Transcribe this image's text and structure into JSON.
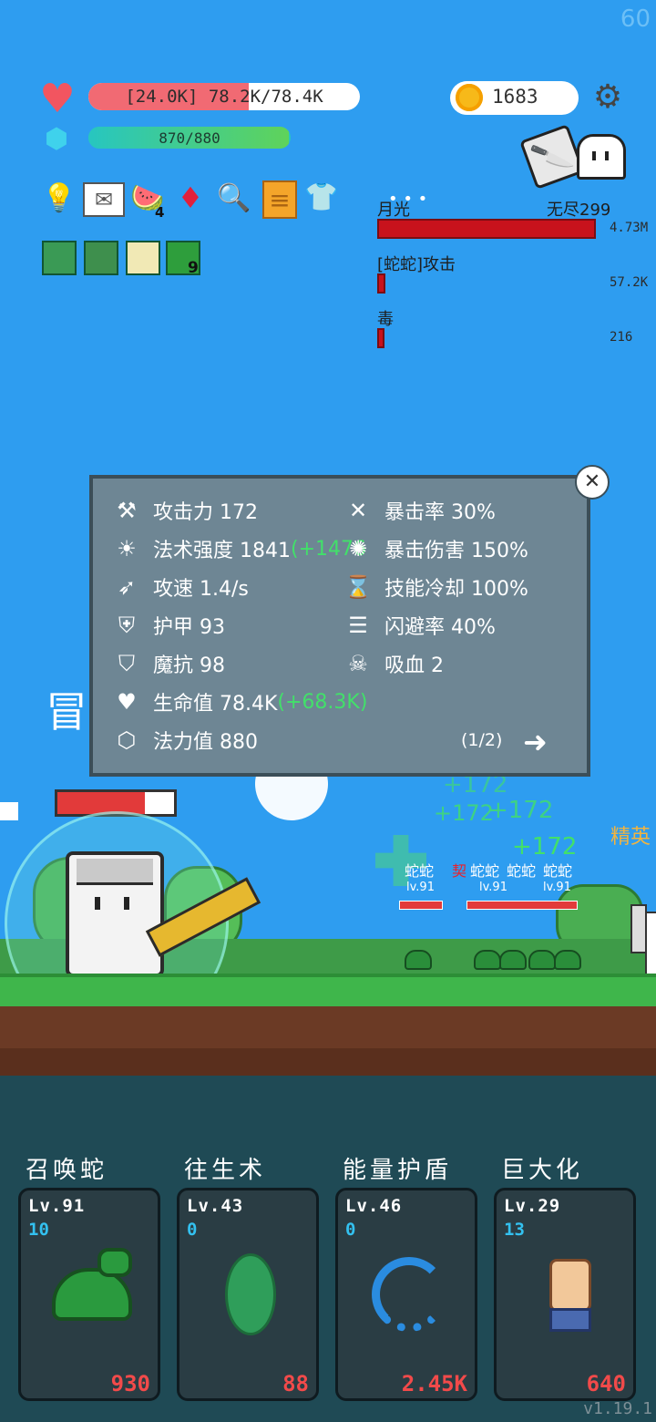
{
  "fps": "60",
  "player": {
    "hp_text": "[24.0K] 78.2K/78.4K",
    "hp_fraction": 0.59,
    "mp_text": "870/880",
    "mp_fraction": 0.99
  },
  "gold": "1683",
  "inventory_badges": {
    "watermelon_count": "4",
    "buff_count": "9"
  },
  "damage_panel": {
    "rows": [
      {
        "name": "月光",
        "mode": "无尽299",
        "value": "4.73M",
        "fraction": 1.0
      },
      {
        "name": "[蛇蛇]攻击",
        "value": "57.2K",
        "fraction": 0.02
      },
      {
        "name": "毒",
        "value": "216",
        "fraction": 0.01
      }
    ]
  },
  "stats": {
    "attack": "攻击力 172",
    "spell_power_base": "法术强度 1841",
    "spell_power_bonus": "(+1476",
    "attack_speed": "攻速 1.4/s",
    "armor": "护甲 93",
    "magic_resist": "魔抗 98",
    "hp_base": "生命值 78.4K",
    "hp_bonus": "(+68.3K)",
    "mana": "法力值 880",
    "crit_rate": "暴击率 30%",
    "crit_damage": "暴击伤害 150%",
    "cooldown": "技能冷却 100%",
    "dodge": "闪避率 40%",
    "lifesteal": "吸血 2",
    "page": "(1/2)"
  },
  "scene": {
    "floating_numbers": [
      "+172",
      "+172",
      "+172",
      "+172"
    ],
    "enemy_label": "蛇蛇",
    "enemy_mark": "契",
    "enemy_level": "lv.91",
    "elite_label": "精英",
    "partial_title": "冒"
  },
  "skills": [
    {
      "name": "召唤蛇",
      "level": "Lv.91",
      "count": "10",
      "cost": "930",
      "icon": "snake-icon"
    },
    {
      "name": "往生术",
      "level": "Lv.43",
      "count": "0",
      "cost": "88",
      "icon": "leaf-icon"
    },
    {
      "name": "能量护盾",
      "level": "Lv.46",
      "count": "0",
      "cost": "2.45K",
      "icon": "refresh-icon"
    },
    {
      "name": "巨大化",
      "level": "Lv.29",
      "count": "13",
      "cost": "640",
      "icon": "fist-icon"
    }
  ],
  "version": "v1.19.1",
  "colors": {
    "sky": "#2e9df0",
    "hp": "#f16a73",
    "cost": "#f24a4a",
    "count": "#33c1f0"
  }
}
